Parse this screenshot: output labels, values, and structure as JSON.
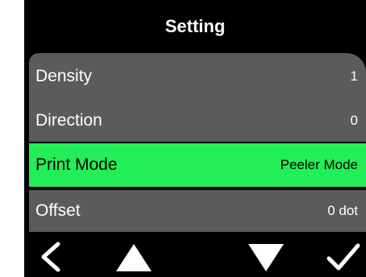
{
  "screen": {
    "title": "Setting"
  },
  "settings": [
    {
      "label": "Density",
      "value": "1",
      "selected": false
    },
    {
      "label": "Direction",
      "value": "0",
      "selected": false
    },
    {
      "label": "Print Mode",
      "value": "Peeler Mode",
      "selected": true
    },
    {
      "label": "Offset",
      "value": "0 dot",
      "selected": false
    }
  ],
  "nav": {
    "icons": [
      "back-icon",
      "up-arrow-icon",
      "down-arrow-icon",
      "check-icon"
    ]
  },
  "colors": {
    "background": "#000000",
    "row": "#5b5b5b",
    "selected_row": "#22ee58",
    "text": "#ffffff"
  }
}
